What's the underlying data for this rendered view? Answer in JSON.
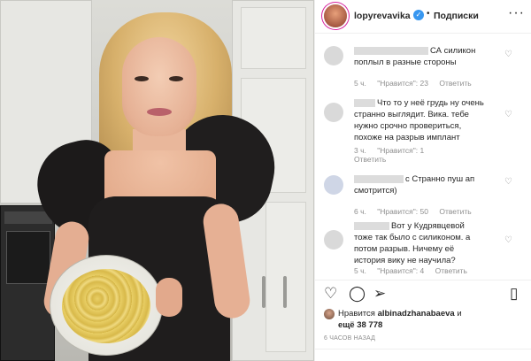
{
  "header": {
    "username": "lopyrevavika",
    "verified_glyph": "✓",
    "separator": "•",
    "follow_label": "Подписки",
    "more_glyph": "···"
  },
  "comments": [
    {
      "text_lines": [
        "СА силикон",
        "поплыл в разные стороны"
      ],
      "time": "5 ч.",
      "likes": "\"Нравится\": 23",
      "reply": "Ответить"
    },
    {
      "text_lines": [
        "Что то у неё грудь ну очень",
        "странно выглядит. Вика. тебе",
        "нужно срочно провериться,",
        "похоже на разрыв имплант"
      ],
      "time": "3 ч.",
      "likes": "\"Нравится\": 1",
      "reply": "Ответить"
    },
    {
      "text_lines": [
        "с Странно пуш ап",
        "смотрится)"
      ],
      "time": "6 ч.",
      "likes": "\"Нравится\": 50",
      "reply": "Ответить"
    },
    {
      "text_lines": [
        "Вот у Кудрявцевой",
        "тоже так было с силиконом. а",
        "потом разрыв. Ничему её",
        "история вику не научила?"
      ],
      "time": "5 ч.",
      "likes": "\"Нравится\": 4",
      "reply": "Ответить"
    }
  ],
  "icons": {
    "heart": "♡",
    "comment": "◯",
    "share": "➢",
    "bookmark": "▯"
  },
  "likes": {
    "prefix": "Нравится",
    "user": "albinadzhanabaeva",
    "suffix_line": "и",
    "more": "ещё 38 778"
  },
  "time_ago": "6 ЧАСОВ НАЗАД"
}
